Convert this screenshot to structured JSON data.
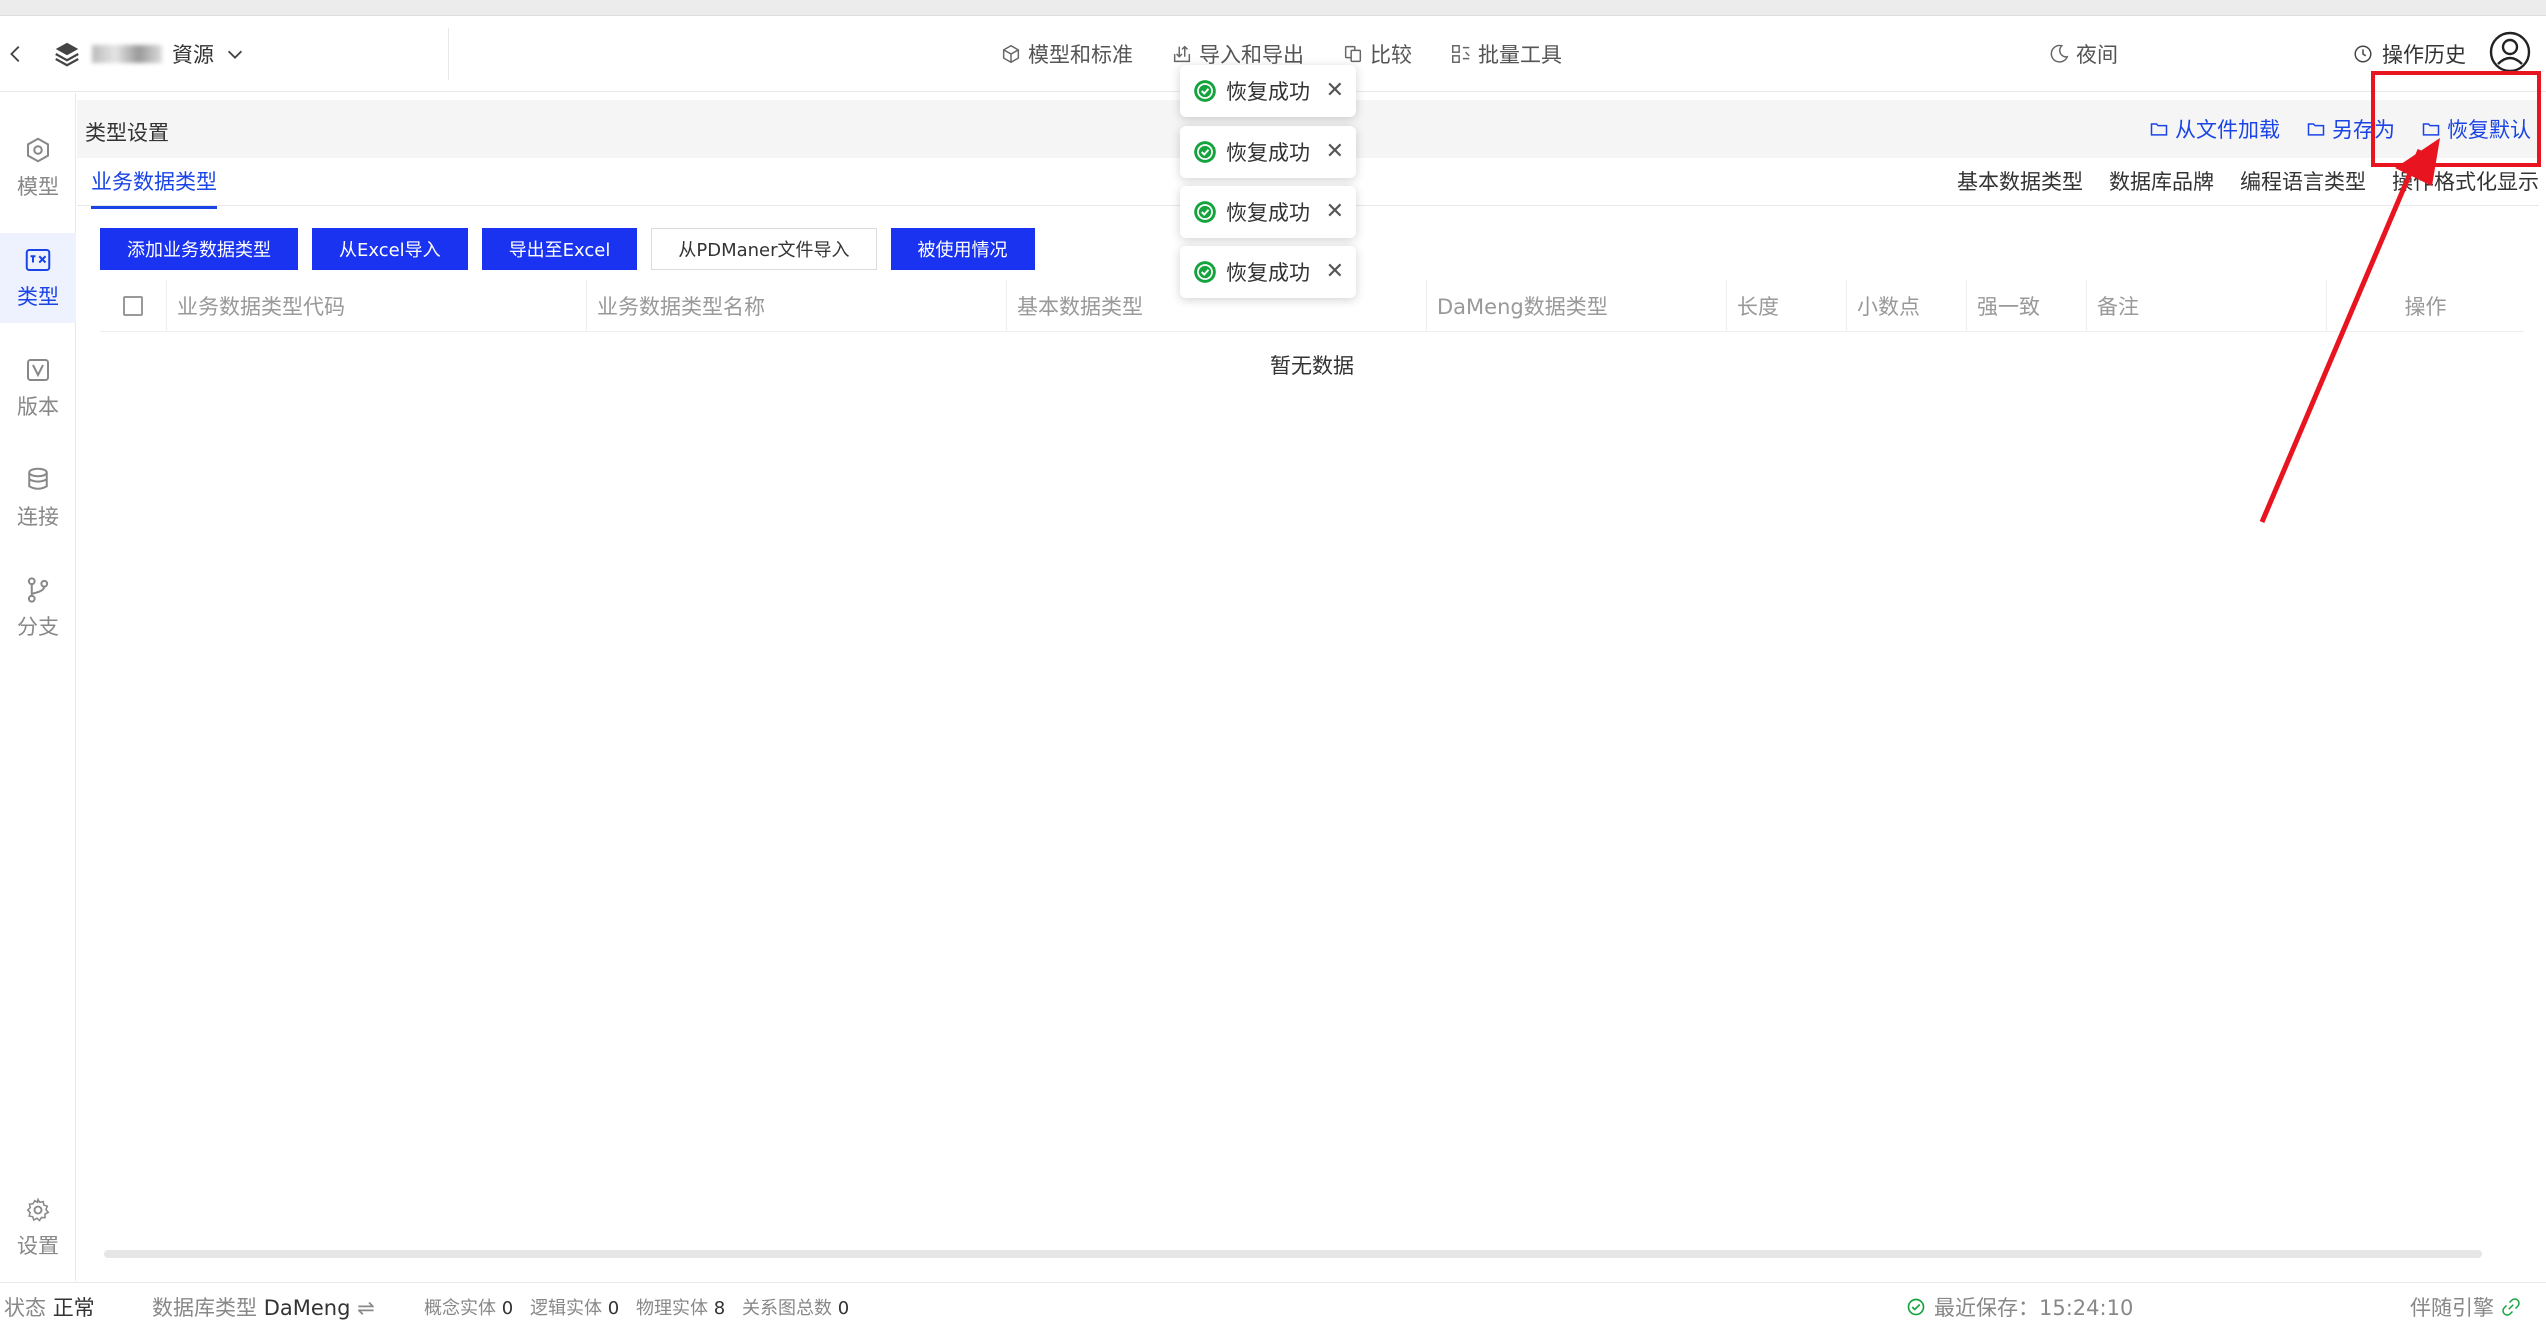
{
  "header": {
    "project_name_suffix": "資源",
    "nav": [
      {
        "label": "模型和标准",
        "icon": "cube-icon"
      },
      {
        "label": "导入和导出",
        "icon": "import-export-icon"
      },
      {
        "label": "比较",
        "icon": "compare-icon"
      },
      {
        "label": "批量工具",
        "icon": "batch-tool-icon"
      }
    ],
    "night_label": "夜间",
    "history_label": "操作历史"
  },
  "sidebar": {
    "items": [
      {
        "label": "模型",
        "icon": "model-icon",
        "active": false
      },
      {
        "label": "类型",
        "icon": "type-icon",
        "active": true
      },
      {
        "label": "版本",
        "icon": "version-icon",
        "active": false
      },
      {
        "label": "连接",
        "icon": "connection-icon",
        "active": false
      },
      {
        "label": "分支",
        "icon": "branch-icon",
        "active": false
      }
    ],
    "settings_label": "设置"
  },
  "content": {
    "title": "类型设置",
    "title_actions": [
      "从文件加载",
      "另存为",
      "恢复默认"
    ],
    "active_tab": "业务数据类型",
    "other_tabs": [
      "基本数据类型",
      "数据库品牌",
      "编程语言类型",
      "操作格式化显示"
    ],
    "buttons": {
      "add": "添加业务数据类型",
      "import_excel": "从Excel导入",
      "export_excel": "导出至Excel",
      "import_pdmaner": "从PDManer文件导入",
      "usage": "被使用情况"
    },
    "columns": [
      "业务数据类型代码",
      "业务数据类型名称",
      "基本数据类型",
      "DaMeng数据类型",
      "长度",
      "小数点",
      "强一致",
      "备注",
      "操作"
    ],
    "empty_text": "暂无数据"
  },
  "toasts": [
    "恢复成功",
    "恢复成功",
    "恢复成功",
    "恢复成功"
  ],
  "status": {
    "state_label": "状态",
    "state_value": "正常",
    "db_type_label": "数据库类型",
    "db_type_value": "DaMeng",
    "concept_label": "概念实体",
    "concept_value": "0",
    "logic_label": "逻辑实体",
    "logic_value": "0",
    "physical_label": "物理实体",
    "physical_value": "8",
    "relation_label": "关系图总数",
    "relation_value": "0",
    "last_saved": "最近保存：15:24:10",
    "engine_label": "伴随引擎"
  },
  "colors": {
    "accent": "#1a44e6",
    "primary_button": "#1a33f0",
    "success": "#14a33c",
    "annotation_red": "#e8141f"
  }
}
